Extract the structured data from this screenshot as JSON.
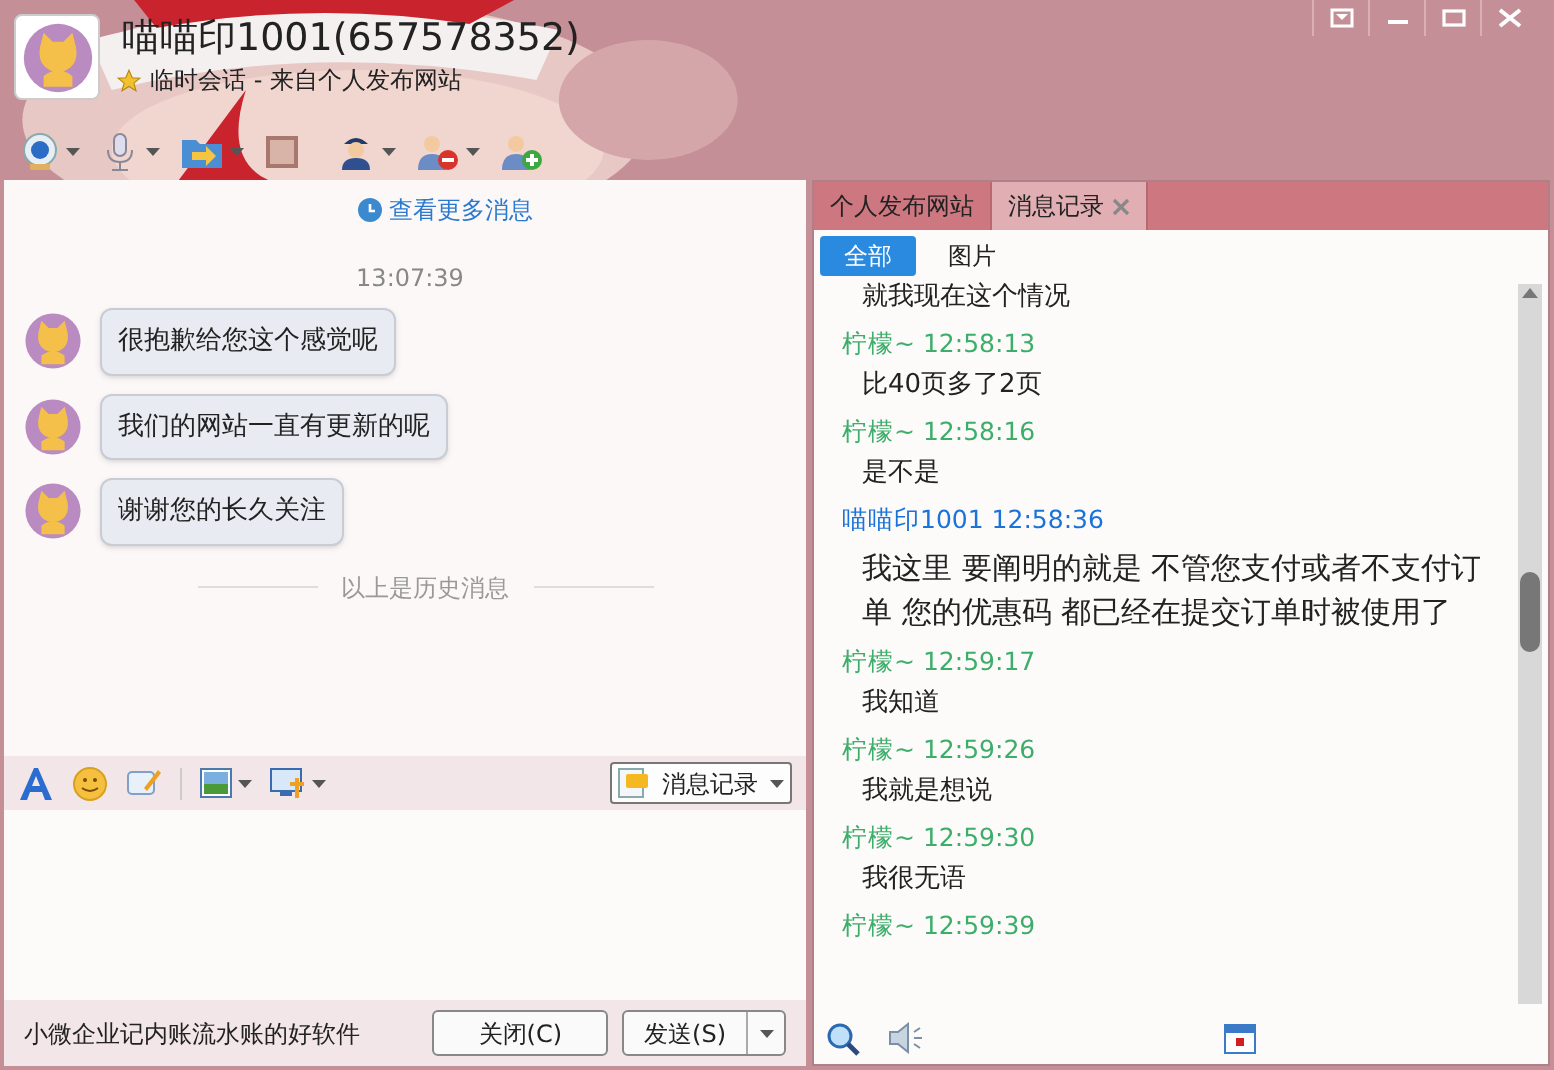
{
  "header": {
    "name": "喵喵印1001(657578352)",
    "subtitle": "临时会话 - 来自个人发布网站"
  },
  "chat": {
    "more_link": "查看更多消息",
    "time": "13:07:39",
    "messages": [
      {
        "text": "很抱歉给您这个感觉呢"
      },
      {
        "text": "我们的网站一直有更新的呢"
      },
      {
        "text": "谢谢您的长久关注"
      }
    ],
    "history_divider": "以上是历史消息"
  },
  "input_toolbar": {
    "history_button": "消息记录"
  },
  "footer": {
    "ad": "小微企业记内账流水账的好软件",
    "buttons": [
      {
        "label": "关闭(C)",
        "kind": "plain"
      },
      {
        "label": "发送(S)",
        "kind": "split"
      }
    ]
  },
  "side_tabs": [
    {
      "label": "个人发布网站",
      "selected": false,
      "closable": false
    },
    {
      "label": "消息记录",
      "selected": true,
      "closable": true
    }
  ],
  "filters": [
    {
      "label": "全部",
      "selected": true
    },
    {
      "label": "图片",
      "selected": false
    }
  ],
  "history": [
    {
      "kind": "message",
      "text": "就我现在这个情况"
    },
    {
      "kind": "peer",
      "sender": "柠檬~",
      "time": "12:58:13"
    },
    {
      "kind": "message",
      "text": "比40页多了2页"
    },
    {
      "kind": "peer",
      "sender": "柠檬~",
      "time": "12:58:16"
    },
    {
      "kind": "message",
      "text": "是不是"
    },
    {
      "kind": "self",
      "sender": "喵喵印1001",
      "time": "12:58:36"
    },
    {
      "kind": "big",
      "text": "我这里 要阐明的就是 不管您支付或者不支付订单 您的优惠码 都已经在提交订单时被使用了"
    },
    {
      "kind": "peer",
      "sender": "柠檬~",
      "time": "12:59:17"
    },
    {
      "kind": "message",
      "text": "我知道"
    },
    {
      "kind": "peer",
      "sender": "柠檬~",
      "time": "12:59:26"
    },
    {
      "kind": "message",
      "text": "我就是想说"
    },
    {
      "kind": "peer",
      "sender": "柠檬~",
      "time": "12:59:30"
    },
    {
      "kind": "message",
      "text": "我很无语"
    },
    {
      "kind": "peer",
      "sender": "柠檬~",
      "time": "12:59:39"
    }
  ]
}
